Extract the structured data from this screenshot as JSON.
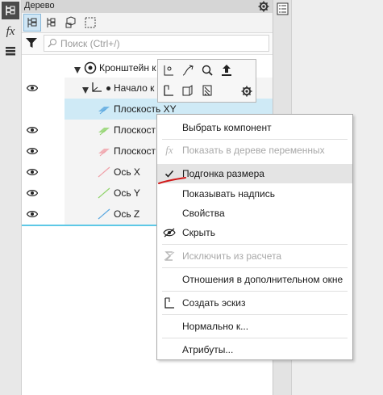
{
  "panel": {
    "title": "Дерево",
    "search_placeholder": "Поиск (Ctrl+/)"
  },
  "left_toolbar": {
    "fx_label": "fx"
  },
  "tree": {
    "root_label": "Кронштейн к",
    "origin_label": "Начало к",
    "rows": [
      {
        "label": "Плоскость XY",
        "color": "#5aa8e0"
      },
      {
        "label": "Плоскост",
        "color": "#8fd36a"
      },
      {
        "label": "Плоскост",
        "color": "#f0a0a8"
      },
      {
        "label": "Ось X",
        "color": "#f0a0a8"
      },
      {
        "label": "Ось Y",
        "color": "#8fd36a"
      },
      {
        "label": "Ось Z",
        "color": "#5aa8e0"
      }
    ]
  },
  "context_menu": {
    "items": [
      {
        "label": "Выбрать компонент",
        "disabled": false
      },
      {
        "label": "Показать в дереве переменных",
        "disabled": true
      },
      {
        "label": "Подгонка размера",
        "checked": true
      },
      {
        "label": "Показывать надпись",
        "disabled": false
      },
      {
        "label": "Свойства",
        "disabled": false
      },
      {
        "label": "Скрыть",
        "disabled": false
      },
      {
        "label": "Исключить из расчета",
        "disabled": true
      },
      {
        "label": "Отношения в дополнительном окне",
        "disabled": false
      },
      {
        "label": "Создать эскиз",
        "disabled": false
      },
      {
        "label": "Нормально к...",
        "disabled": false
      },
      {
        "label": "Атрибуты...",
        "disabled": false
      }
    ]
  },
  "colors": {
    "selection": "#cfeaf6",
    "accent_line": "#5ec8e6",
    "annotation": "#d11a1a"
  }
}
